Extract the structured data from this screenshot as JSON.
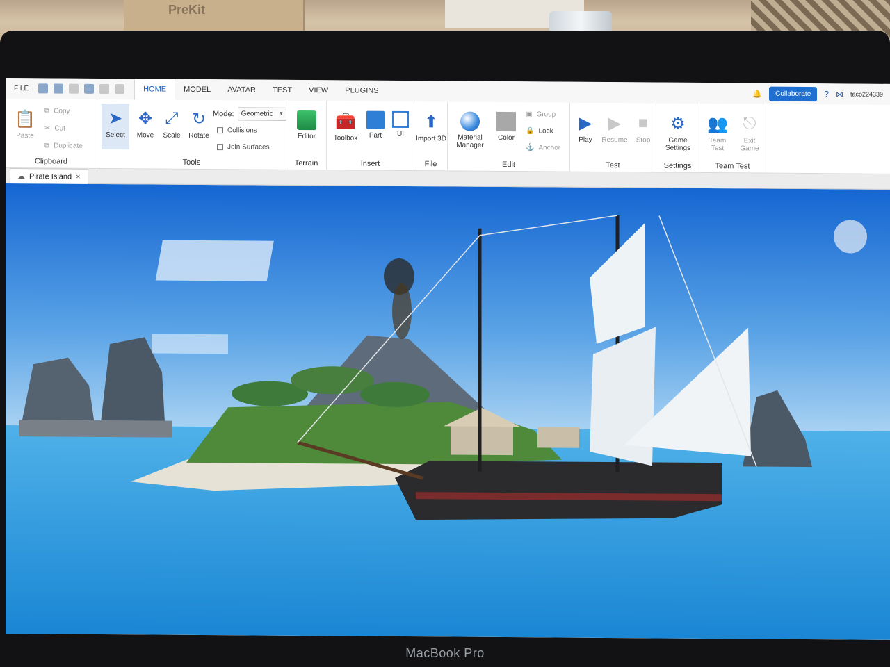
{
  "environment": {
    "laptop_brand": "MacBook Pro"
  },
  "topbar": {
    "file_label": "FILE",
    "tabs": [
      "HOME",
      "MODEL",
      "AVATAR",
      "TEST",
      "VIEW",
      "PLUGINS"
    ],
    "active_tab": "HOME",
    "collaborate_label": "Collaborate",
    "username": "taco224339"
  },
  "ribbon": {
    "clipboard": {
      "label": "Clipboard",
      "paste": "Paste",
      "copy": "Copy",
      "cut": "Cut",
      "duplicate": "Duplicate"
    },
    "tools": {
      "label": "Tools",
      "select": "Select",
      "move": "Move",
      "scale": "Scale",
      "rotate": "Rotate",
      "mode_label": "Mode:",
      "mode_value": "Geometric",
      "collisions": "Collisions",
      "join_surfaces": "Join Surfaces"
    },
    "terrain": {
      "label": "Terrain",
      "editor": "Editor"
    },
    "insert": {
      "label": "Insert",
      "toolbox": "Toolbox",
      "part": "Part",
      "ui": "UI"
    },
    "file": {
      "label": "File",
      "import3d": "Import 3D"
    },
    "edit": {
      "label": "Edit",
      "material_manager": "Material Manager",
      "color": "Color",
      "group": "Group",
      "lock": "Lock",
      "anchor": "Anchor"
    },
    "test": {
      "label": "Test",
      "play": "Play",
      "resume": "Resume",
      "stop": "Stop"
    },
    "settings": {
      "label": "Settings",
      "game_settings": "Game Settings"
    },
    "team_test": {
      "label": "Team Test",
      "team_test": "Team Test",
      "exit_game": "Exit Game"
    }
  },
  "document": {
    "tab_name": "Pirate Island"
  },
  "colors": {
    "accent": "#1f63c4",
    "collaborate": "#1f6fd0",
    "sky_top": "#1b6fd6",
    "sea": "#1f8fd8"
  },
  "icons": [
    "cloud-icon",
    "close-icon",
    "select-arrow-icon",
    "move-icon",
    "scale-icon",
    "rotate-icon",
    "terrain-editor-icon",
    "toolbox-icon",
    "part-icon",
    "ui-icon",
    "import-icon",
    "material-sphere-icon",
    "color-swatch-icon",
    "play-icon",
    "resume-icon",
    "stop-icon",
    "gear-icon",
    "bell-icon",
    "help-icon",
    "share-icon",
    "view-cube-icon"
  ]
}
